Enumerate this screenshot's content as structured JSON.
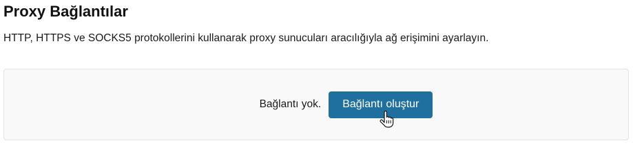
{
  "section": {
    "title": "Proxy Bağlantılar",
    "description": "HTTP, HTTPS ve SOCKS5 protokollerini kullanarak proxy sunucuları aracılığıyla ağ erişimini ayarlayın."
  },
  "empty_state": {
    "message": "Bağlantı yok.",
    "create_button_label": "Bağlantı oluştur"
  },
  "icons": {
    "cursor": "hand-pointer-icon"
  },
  "colors": {
    "accent": "#1f6f9f",
    "panel_background": "#f9f9f9",
    "panel_border": "#e3e3e3"
  }
}
